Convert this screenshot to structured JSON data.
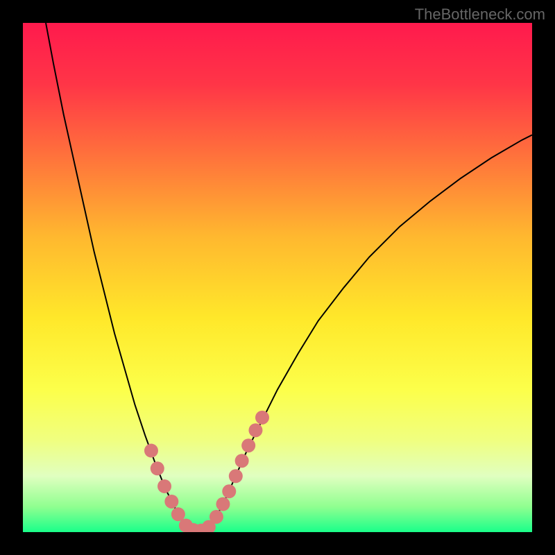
{
  "watermark": "TheBottleneck.com",
  "chart_data": {
    "type": "line",
    "title": "",
    "xlabel": "",
    "ylabel": "",
    "xlim": [
      0,
      100
    ],
    "ylim": [
      0,
      100
    ],
    "gradient_stops": [
      {
        "offset": 0,
        "color": "#ff1a4d"
      },
      {
        "offset": 0.12,
        "color": "#ff3547"
      },
      {
        "offset": 0.28,
        "color": "#ff7a3a"
      },
      {
        "offset": 0.42,
        "color": "#ffb82f"
      },
      {
        "offset": 0.58,
        "color": "#ffe82a"
      },
      {
        "offset": 0.72,
        "color": "#fcff4a"
      },
      {
        "offset": 0.82,
        "color": "#f0ff80"
      },
      {
        "offset": 0.89,
        "color": "#e0ffc0"
      },
      {
        "offset": 0.95,
        "color": "#90ff90"
      },
      {
        "offset": 1.0,
        "color": "#1aff8a"
      }
    ],
    "series": [
      {
        "name": "bottleneck-curve",
        "type": "line",
        "color": "#000000",
        "stroke_width": 2,
        "points": [
          {
            "x": 4.5,
            "y": 100
          },
          {
            "x": 6,
            "y": 92
          },
          {
            "x": 8,
            "y": 82
          },
          {
            "x": 10,
            "y": 73
          },
          {
            "x": 12,
            "y": 64
          },
          {
            "x": 14,
            "y": 55
          },
          {
            "x": 16,
            "y": 47
          },
          {
            "x": 18,
            "y": 39
          },
          {
            "x": 20,
            "y": 32
          },
          {
            "x": 22,
            "y": 25
          },
          {
            "x": 24,
            "y": 19
          },
          {
            "x": 26,
            "y": 13.5
          },
          {
            "x": 28,
            "y": 8.5
          },
          {
            "x": 30,
            "y": 4.5
          },
          {
            "x": 31.5,
            "y": 2
          },
          {
            "x": 33,
            "y": 0.7
          },
          {
            "x": 34.5,
            "y": 0.2
          },
          {
            "x": 36,
            "y": 0.7
          },
          {
            "x": 38,
            "y": 3
          },
          {
            "x": 40,
            "y": 7
          },
          {
            "x": 42,
            "y": 11.5
          },
          {
            "x": 44,
            "y": 16
          },
          {
            "x": 47,
            "y": 22
          },
          {
            "x": 50,
            "y": 28
          },
          {
            "x": 54,
            "y": 35
          },
          {
            "x": 58,
            "y": 41.5
          },
          {
            "x": 63,
            "y": 48
          },
          {
            "x": 68,
            "y": 54
          },
          {
            "x": 74,
            "y": 60
          },
          {
            "x": 80,
            "y": 65
          },
          {
            "x": 86,
            "y": 69.5
          },
          {
            "x": 92,
            "y": 73.5
          },
          {
            "x": 98,
            "y": 77
          },
          {
            "x": 100,
            "y": 78
          }
        ]
      },
      {
        "name": "data-points",
        "type": "scatter",
        "color": "#d97878",
        "radius": 10,
        "points": [
          {
            "x": 25.2,
            "y": 16
          },
          {
            "x": 26.4,
            "y": 12.5
          },
          {
            "x": 27.8,
            "y": 9
          },
          {
            "x": 29.2,
            "y": 6
          },
          {
            "x": 30.5,
            "y": 3.5
          },
          {
            "x": 32,
            "y": 1.3
          },
          {
            "x": 33.5,
            "y": 0.4
          },
          {
            "x": 35,
            "y": 0.3
          },
          {
            "x": 36.5,
            "y": 1
          },
          {
            "x": 38,
            "y": 3
          },
          {
            "x": 39.3,
            "y": 5.5
          },
          {
            "x": 40.5,
            "y": 8
          },
          {
            "x": 41.8,
            "y": 11
          },
          {
            "x": 43,
            "y": 14
          },
          {
            "x": 44.3,
            "y": 17
          },
          {
            "x": 45.7,
            "y": 20
          },
          {
            "x": 47,
            "y": 22.5
          }
        ]
      }
    ]
  }
}
